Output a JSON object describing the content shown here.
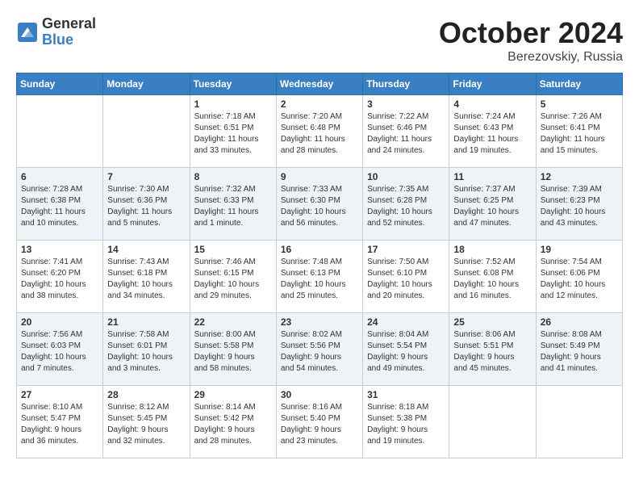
{
  "logo": {
    "general": "General",
    "blue": "Blue"
  },
  "title": "October 2024",
  "location": "Berezovskiy, Russia",
  "days_of_week": [
    "Sunday",
    "Monday",
    "Tuesday",
    "Wednesday",
    "Thursday",
    "Friday",
    "Saturday"
  ],
  "weeks": [
    [
      {
        "day": "",
        "content": ""
      },
      {
        "day": "",
        "content": ""
      },
      {
        "day": "1",
        "content": "Sunrise: 7:18 AM\nSunset: 6:51 PM\nDaylight: 11 hours\nand 33 minutes."
      },
      {
        "day": "2",
        "content": "Sunrise: 7:20 AM\nSunset: 6:48 PM\nDaylight: 11 hours\nand 28 minutes."
      },
      {
        "day": "3",
        "content": "Sunrise: 7:22 AM\nSunset: 6:46 PM\nDaylight: 11 hours\nand 24 minutes."
      },
      {
        "day": "4",
        "content": "Sunrise: 7:24 AM\nSunset: 6:43 PM\nDaylight: 11 hours\nand 19 minutes."
      },
      {
        "day": "5",
        "content": "Sunrise: 7:26 AM\nSunset: 6:41 PM\nDaylight: 11 hours\nand 15 minutes."
      }
    ],
    [
      {
        "day": "6",
        "content": "Sunrise: 7:28 AM\nSunset: 6:38 PM\nDaylight: 11 hours\nand 10 minutes."
      },
      {
        "day": "7",
        "content": "Sunrise: 7:30 AM\nSunset: 6:36 PM\nDaylight: 11 hours\nand 5 minutes."
      },
      {
        "day": "8",
        "content": "Sunrise: 7:32 AM\nSunset: 6:33 PM\nDaylight: 11 hours\nand 1 minute."
      },
      {
        "day": "9",
        "content": "Sunrise: 7:33 AM\nSunset: 6:30 PM\nDaylight: 10 hours\nand 56 minutes."
      },
      {
        "day": "10",
        "content": "Sunrise: 7:35 AM\nSunset: 6:28 PM\nDaylight: 10 hours\nand 52 minutes."
      },
      {
        "day": "11",
        "content": "Sunrise: 7:37 AM\nSunset: 6:25 PM\nDaylight: 10 hours\nand 47 minutes."
      },
      {
        "day": "12",
        "content": "Sunrise: 7:39 AM\nSunset: 6:23 PM\nDaylight: 10 hours\nand 43 minutes."
      }
    ],
    [
      {
        "day": "13",
        "content": "Sunrise: 7:41 AM\nSunset: 6:20 PM\nDaylight: 10 hours\nand 38 minutes."
      },
      {
        "day": "14",
        "content": "Sunrise: 7:43 AM\nSunset: 6:18 PM\nDaylight: 10 hours\nand 34 minutes."
      },
      {
        "day": "15",
        "content": "Sunrise: 7:46 AM\nSunset: 6:15 PM\nDaylight: 10 hours\nand 29 minutes."
      },
      {
        "day": "16",
        "content": "Sunrise: 7:48 AM\nSunset: 6:13 PM\nDaylight: 10 hours\nand 25 minutes."
      },
      {
        "day": "17",
        "content": "Sunrise: 7:50 AM\nSunset: 6:10 PM\nDaylight: 10 hours\nand 20 minutes."
      },
      {
        "day": "18",
        "content": "Sunrise: 7:52 AM\nSunset: 6:08 PM\nDaylight: 10 hours\nand 16 minutes."
      },
      {
        "day": "19",
        "content": "Sunrise: 7:54 AM\nSunset: 6:06 PM\nDaylight: 10 hours\nand 12 minutes."
      }
    ],
    [
      {
        "day": "20",
        "content": "Sunrise: 7:56 AM\nSunset: 6:03 PM\nDaylight: 10 hours\nand 7 minutes."
      },
      {
        "day": "21",
        "content": "Sunrise: 7:58 AM\nSunset: 6:01 PM\nDaylight: 10 hours\nand 3 minutes."
      },
      {
        "day": "22",
        "content": "Sunrise: 8:00 AM\nSunset: 5:58 PM\nDaylight: 9 hours\nand 58 minutes."
      },
      {
        "day": "23",
        "content": "Sunrise: 8:02 AM\nSunset: 5:56 PM\nDaylight: 9 hours\nand 54 minutes."
      },
      {
        "day": "24",
        "content": "Sunrise: 8:04 AM\nSunset: 5:54 PM\nDaylight: 9 hours\nand 49 minutes."
      },
      {
        "day": "25",
        "content": "Sunrise: 8:06 AM\nSunset: 5:51 PM\nDaylight: 9 hours\nand 45 minutes."
      },
      {
        "day": "26",
        "content": "Sunrise: 8:08 AM\nSunset: 5:49 PM\nDaylight: 9 hours\nand 41 minutes."
      }
    ],
    [
      {
        "day": "27",
        "content": "Sunrise: 8:10 AM\nSunset: 5:47 PM\nDaylight: 9 hours\nand 36 minutes."
      },
      {
        "day": "28",
        "content": "Sunrise: 8:12 AM\nSunset: 5:45 PM\nDaylight: 9 hours\nand 32 minutes."
      },
      {
        "day": "29",
        "content": "Sunrise: 8:14 AM\nSunset: 5:42 PM\nDaylight: 9 hours\nand 28 minutes."
      },
      {
        "day": "30",
        "content": "Sunrise: 8:16 AM\nSunset: 5:40 PM\nDaylight: 9 hours\nand 23 minutes."
      },
      {
        "day": "31",
        "content": "Sunrise: 8:18 AM\nSunset: 5:38 PM\nDaylight: 9 hours\nand 19 minutes."
      },
      {
        "day": "",
        "content": ""
      },
      {
        "day": "",
        "content": ""
      }
    ]
  ]
}
